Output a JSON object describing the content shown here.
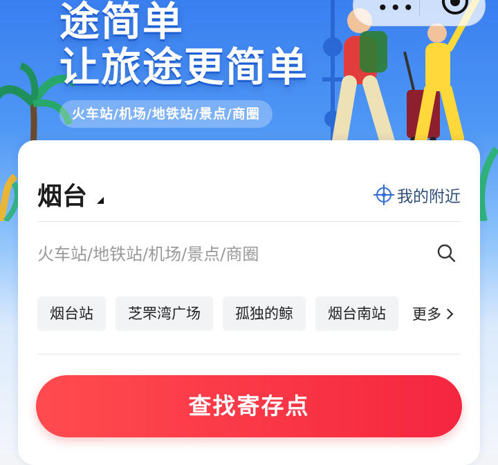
{
  "banner": {
    "title_line1": "途简单",
    "title_line2": "让旅途更简单",
    "tagline": "火车站/机场/地铁站/景点/商圈"
  },
  "location": {
    "city": "烟台",
    "nearby_label": "我的附近"
  },
  "search": {
    "placeholder": "火车站/地铁站/机场/景点/商圈"
  },
  "quick_picks": [
    "烟台站",
    "芝罘湾广场",
    "孤独的鲸",
    "烟台南站"
  ],
  "more_label": "更多",
  "cta_label": "查找寄存点",
  "colors": {
    "cta_start": "#ff4b4f",
    "cta_end": "#f5263f",
    "accent_blue": "#2f6dd6",
    "banner_blue": "#3a7ff0"
  },
  "icons": {
    "nearby": "crosshair-icon",
    "search": "search-icon",
    "more": "chevron-right-icon",
    "menu": "more-dots-icon",
    "close": "target-icon"
  }
}
